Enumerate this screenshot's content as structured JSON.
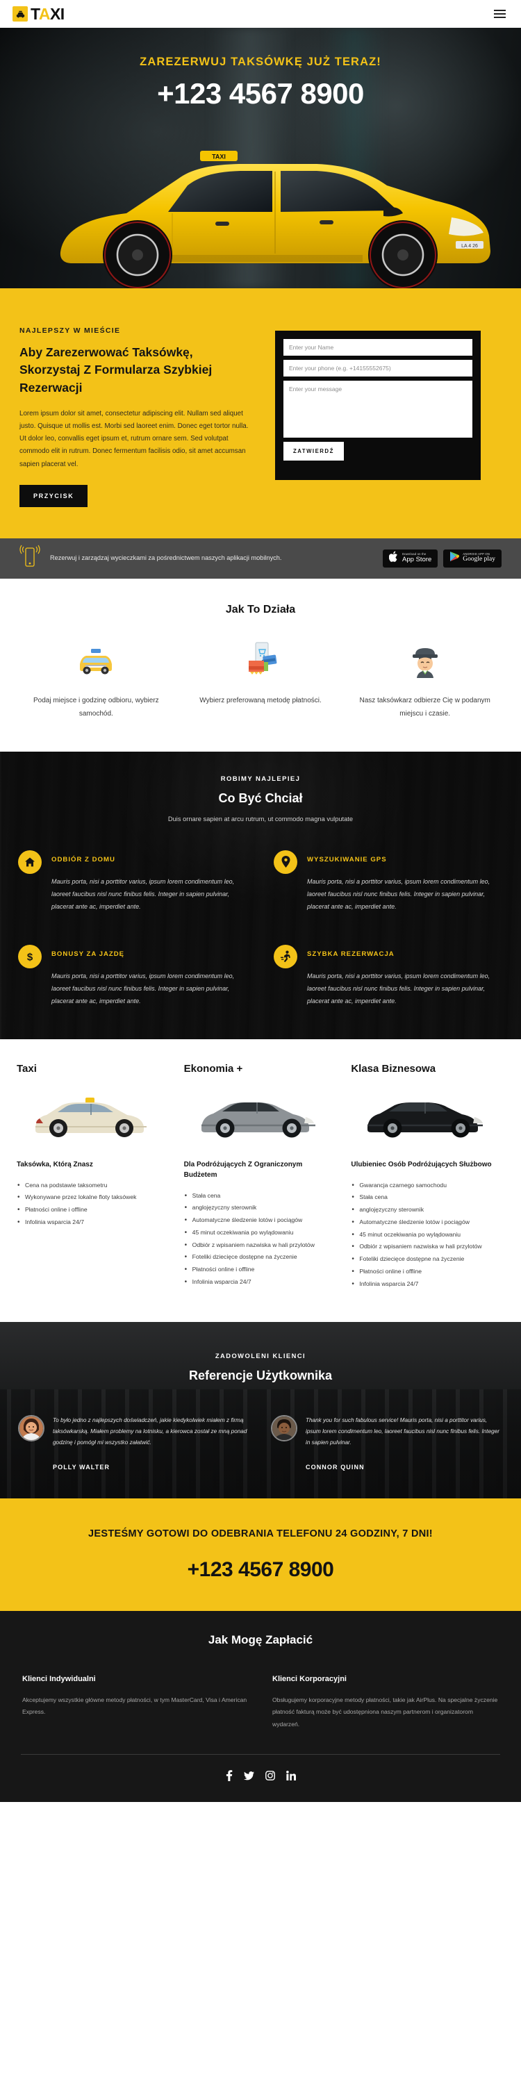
{
  "header": {
    "logo_text_1": "T",
    "logo_text_accent": "A",
    "logo_text_2": "XI",
    "logo_icon": "taxi-car-icon",
    "menu_icon": "hamburger-menu-icon"
  },
  "hero": {
    "eyebrow": "ZAREZERWUJ TAKSÓWKĘ JUŻ TERAZ!",
    "phone": "+123 4567 8900",
    "car_image_alt": "yellow-sports-car"
  },
  "booking": {
    "eyebrow": "NAJLEPSZY W MIEŚCIE",
    "title": "Aby Zarezerwować Taksówkę, Skorzystaj Z Formularza Szybkiej Rezerwacji",
    "body": "Lorem ipsum dolor sit amet, consectetur adipiscing elit. Nullam sed aliquet justo. Quisque ut mollis est. Morbi sed laoreet enim. Donec eget tortor nulla. Ut dolor leo, convallis eget ipsum et, rutrum ornare sem. Sed volutpat commodo elit in rutrum. Donec fermentum facilisis odio, sit amet accumsan sapien placerat vel.",
    "button": "PRZYCISK",
    "form": {
      "name_placeholder": "Enter your Name",
      "phone_placeholder": "Enter your phone (e.g. +14155552675)",
      "message_placeholder": "Enter your message",
      "name_value": "",
      "phone_value": "",
      "message_value": "",
      "submit": "ZATWIERDŹ"
    }
  },
  "appstrip": {
    "text": "Rezerwuj i zarządzaj wycieczkami za pośrednictwem naszych aplikacji mobilnych.",
    "phone_icon": "mobile-phone-signal-icon",
    "appstore": {
      "small": "Download on the",
      "big": "App Store",
      "icon": "apple-icon"
    },
    "googleplay": {
      "small": "ANDROID APP ON",
      "big": "Google play",
      "icon": "google-play-triangle-icon"
    }
  },
  "how": {
    "title": "Jak To Działa",
    "steps": [
      {
        "icon": "taxi-cab-icon",
        "text": "Podaj miejsce i godzinę odbioru, wybierz samochód."
      },
      {
        "icon": "wallet-card-phone-icon",
        "text": "Wybierz preferowaną metodę płatności."
      },
      {
        "icon": "taxi-driver-icon",
        "text": "Nasz taksówkarz odbierze Cię w podanym miejscu i czasie."
      }
    ]
  },
  "features": {
    "eyebrow": "ROBIMY NAJLEPIEJ",
    "title": "Co Być Chciał",
    "subtitle": "Duis ornare sapien at arcu rutrum, ut commodo magna vulputate",
    "body_text": "Mauris porta, nisi a porttitor varius, ipsum lorem condimentum leo, laoreet faucibus nisl nunc finibus felis. Integer in sapien pulvinar, placerat ante ac, imperdiet ante.",
    "items": [
      {
        "icon": "home-icon",
        "title": "ODBIÓR Z DOMU"
      },
      {
        "icon": "map-pin-icon",
        "title": "WYSZUKIWANIE GPS"
      },
      {
        "icon": "dollar-sign-icon",
        "title": "BONUSY ZA JAZDĘ"
      },
      {
        "icon": "running-person-icon",
        "title": "SZYBKA REZERWACJA"
      }
    ]
  },
  "fleet": [
    {
      "name": "Taxi",
      "image": "beige-sedan-taxi",
      "subtitle": "Taksówka, Którą Znasz",
      "features": [
        "Cena na podstawie taksometru",
        "Wykonywane przez lokalne floty taksówek",
        "Płatności online i offline",
        "Infolinia wsparcia 24/7"
      ]
    },
    {
      "name": "Ekonomia +",
      "image": "grey-sedan-car",
      "subtitle": "Dla Podróżujących Z Ograniczonym Budżetem",
      "features": [
        "Stała cena",
        "anglojęzyczny sterownik",
        "Automatyczne śledzenie lotów i pociągów",
        "45 minut oczekiwania po wylądowaniu",
        "Odbiór z wpisaniem nazwiska w hali przylotów",
        "Foteliki dziecięce dostępne na życzenie",
        "Płatności online i offline",
        "Infolinia wsparcia 24/7"
      ]
    },
    {
      "name": "Klasa Biznesowa",
      "image": "black-luxury-sedan",
      "subtitle": "Ulubieniec Osób Podróżujących Służbowo",
      "features": [
        "Gwarancja czarnego samochodu",
        "Stała cena",
        "anglojęzyczny sterownik",
        "Automatyczne śledzenie lotów i pociągów",
        "45 minut oczekiwania po wylądowaniu",
        "Odbiór z wpisaniem nazwiska w hali przylotów",
        "Foteliki dziecięce dostępne na życzenie",
        "Płatności online i offline",
        "Infolinia wsparcia 24/7"
      ]
    }
  ],
  "testimonials": {
    "eyebrow": "ZADOWOLENI KLIENCI",
    "title": "Referencje Użytkownika",
    "items": [
      {
        "avatar": "woman-avatar",
        "quote": "To było jedno z najlepszych doświadczeń, jakie kiedykolwiek miałem z firmą taksówkarską. Miałem problemy na lotnisku, a kierowca został ze mną ponad godzinę i pomógł mi wszystko załatwić.",
        "author": "POLLY WALTER"
      },
      {
        "avatar": "man-avatar",
        "quote": "Thank you for such fabulous service! Mauris porta, nisi a porttitor varius, ipsum lorem condimentum leo, laoreet faucibus nisl nunc finibus felis. Integer in sapien pulvinar.",
        "author": "CONNOR QUINN"
      }
    ]
  },
  "cta": {
    "headline": "JESTEŚMY GOTOWI DO ODEBRANIA TELEFONU 24 GODZINY, 7 DNI!",
    "phone": "+123 4567 8900"
  },
  "payments": {
    "title": "Jak Mogę Zapłacić",
    "columns": [
      {
        "heading": "Klienci Indywidualni",
        "body": "Akceptujemy wszystkie główne metody płatności, w tym MasterCard, Visa i American Express."
      },
      {
        "heading": "Klienci Korporacyjni",
        "body": "Obsługujemy korporacyjne metody płatności, takie jak AirPlus. Na specjalne życzenie płatność fakturą może być udostępniona naszym partnerom i organizatorom wydarzeń."
      }
    ],
    "social": [
      "facebook-icon",
      "twitter-icon",
      "instagram-icon",
      "linkedin-icon"
    ]
  },
  "colors": {
    "accent": "#f3c218",
    "dark": "#171717",
    "grey_strip": "#4a4a4a"
  }
}
